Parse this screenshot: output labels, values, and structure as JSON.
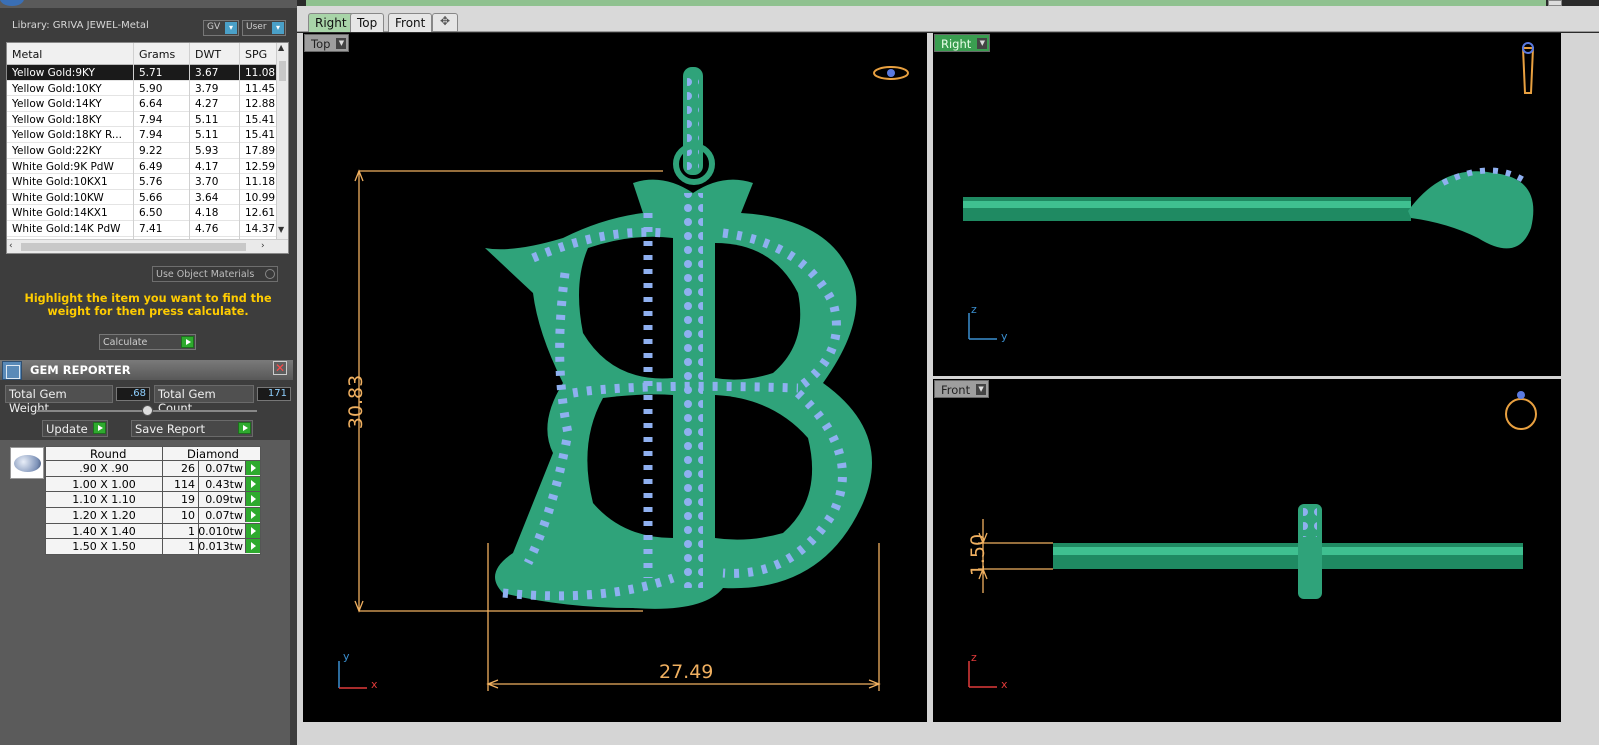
{
  "library": {
    "label": "Library: GRIVA JEWEL-Metal",
    "gv_label": "GV",
    "user_label": "User",
    "columns": [
      "Metal",
      "Grams",
      "DWT",
      "SPG"
    ],
    "rows": [
      {
        "metal": "Yellow Gold:9KY",
        "grams": "5.71",
        "dwt": "3.67",
        "spg": "11.08"
      },
      {
        "metal": "Yellow Gold:10KY",
        "grams": "5.90",
        "dwt": "3.79",
        "spg": "11.45"
      },
      {
        "metal": "Yellow Gold:14KY",
        "grams": "6.64",
        "dwt": "4.27",
        "spg": "12.88"
      },
      {
        "metal": "Yellow Gold:18KY",
        "grams": "7.94",
        "dwt": "5.11",
        "spg": "15.41"
      },
      {
        "metal": "Yellow Gold:18KY R...",
        "grams": "7.94",
        "dwt": "5.11",
        "spg": "15.41"
      },
      {
        "metal": "Yellow Gold:22KY",
        "grams": "9.22",
        "dwt": "5.93",
        "spg": "17.89"
      },
      {
        "metal": "White Gold:9K PdW",
        "grams": "6.49",
        "dwt": "4.17",
        "spg": "12.59"
      },
      {
        "metal": "White Gold:10KX1",
        "grams": "5.76",
        "dwt": "3.70",
        "spg": "11.18"
      },
      {
        "metal": "White Gold:10KW",
        "grams": "5.66",
        "dwt": "3.64",
        "spg": "10.99"
      },
      {
        "metal": "White Gold:14KX1",
        "grams": "6.50",
        "dwt": "4.18",
        "spg": "12.61"
      },
      {
        "metal": "White Gold:14K PdW",
        "grams": "7.41",
        "dwt": "4.76",
        "spg": "14.37"
      }
    ],
    "use_object_materials": "Use Object Materials",
    "hint": "Highlight the item you want to find the weight for then press calculate.",
    "calculate": "Calculate"
  },
  "gem_reporter": {
    "title": "GEM REPORTER",
    "total_weight_label": "Total Gem Weight",
    "total_weight_value": ".68",
    "total_count_label": "Total Gem Count",
    "total_count_value": "171",
    "update": "Update",
    "save_report": "Save Report",
    "shape": "Round",
    "stone": "Diamond",
    "rows": [
      {
        "size": ".90 X .90",
        "count": "26",
        "weight": "0.07tw"
      },
      {
        "size": "1.00 X 1.00",
        "count": "114",
        "weight": "0.43tw"
      },
      {
        "size": "1.10 X 1.10",
        "count": "19",
        "weight": "0.09tw"
      },
      {
        "size": "1.20 X 1.20",
        "count": "10",
        "weight": "0.07tw"
      },
      {
        "size": "1.40 X 1.40",
        "count": "1",
        "weight": "0.010tw"
      },
      {
        "size": "1.50 X 1.50",
        "count": "1",
        "weight": "0.013tw"
      }
    ]
  },
  "tabs": [
    "Right",
    "Top",
    "Front"
  ],
  "viewports": {
    "top": {
      "label": "Top",
      "height_dim": "30.83",
      "width_dim": "27.49"
    },
    "right": {
      "label": "Right"
    },
    "front": {
      "label": "Front",
      "thickness_dim": "1.50"
    }
  },
  "axes": {
    "x": "x",
    "y": "y",
    "z": "z"
  },
  "colors": {
    "metal": "#2fa37a",
    "gem": "#8fb0f0",
    "dimension": "#f0b060",
    "selected_row": "#1a1a1a"
  }
}
